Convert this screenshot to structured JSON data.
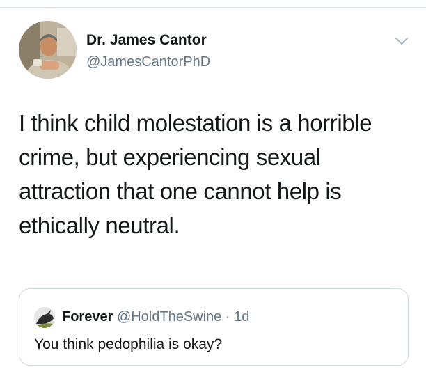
{
  "tweet": {
    "author_name": "Dr. James Cantor",
    "author_handle": "@JamesCantorPhD",
    "text": "I think child molestation is a horrible crime, but experiencing sexual attraction that one cannot help is ethically neutral.",
    "menu_icon": "chevron-down-icon"
  },
  "quoted_tweet": {
    "author_name": "Forever",
    "author_handle": "@HoldTheSwine",
    "separator": "·",
    "age": "1d",
    "text": "You think pedophilia is okay?"
  },
  "colors": {
    "text_primary": "#14171a",
    "text_secondary": "#657786",
    "border": "#cfd9de"
  }
}
